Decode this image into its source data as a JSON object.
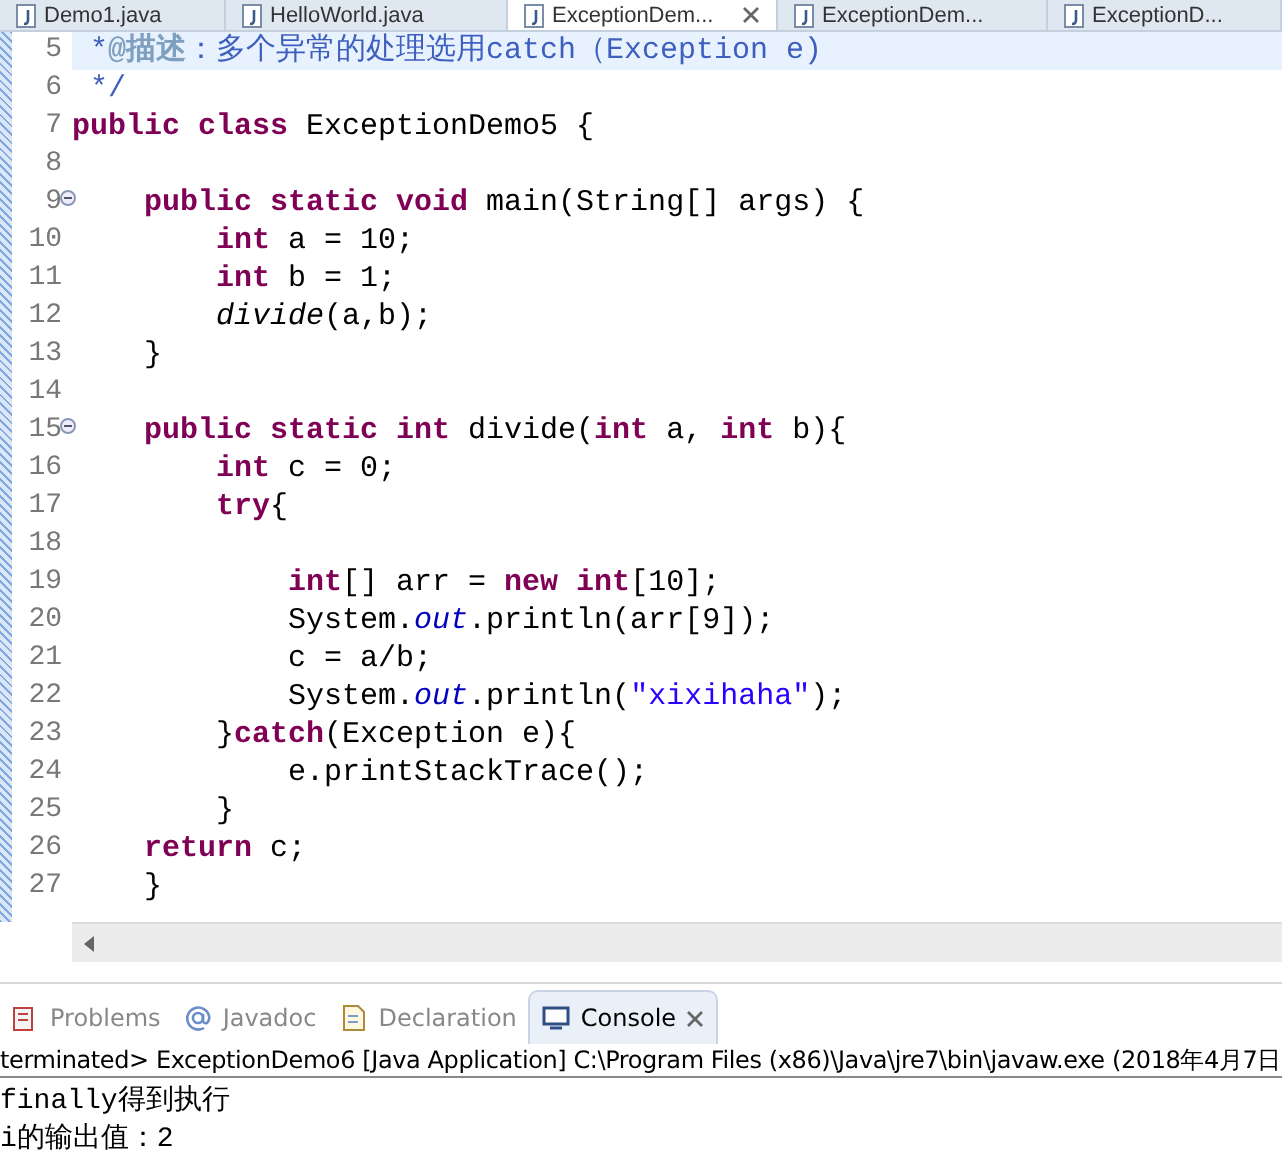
{
  "editor_tabs": [
    {
      "label": "Demo1.java",
      "selected": false,
      "closable": false
    },
    {
      "label": "HelloWorld.java",
      "selected": false,
      "closable": false
    },
    {
      "label": "ExceptionDem...",
      "selected": true,
      "closable": true
    },
    {
      "label": "ExceptionDem...",
      "selected": false,
      "closable": false
    },
    {
      "label": "ExceptionD...",
      "selected": false,
      "closable": false
    }
  ],
  "code_lines": [
    {
      "number": "5",
      "fold": false,
      "current": true,
      "tokens": [
        {
          "kind": "comment",
          "text": " *"
        },
        {
          "kind": "tag",
          "text": "@描述"
        },
        {
          "kind": "comment",
          "text": "：多个异常的处理选用catch（Exception e)"
        }
      ]
    },
    {
      "number": "6",
      "fold": false,
      "current": false,
      "tokens": [
        {
          "kind": "comment",
          "text": " */"
        }
      ]
    },
    {
      "number": "7",
      "fold": false,
      "current": false,
      "tokens": [
        {
          "kind": "kw",
          "text": "public class"
        },
        {
          "kind": "plain",
          "text": " ExceptionDemo5 {"
        }
      ]
    },
    {
      "number": "8",
      "fold": false,
      "current": false
    },
    {
      "number": "9",
      "fold": true,
      "current": false,
      "tokens": [
        {
          "kind": "kw",
          "text": "    public static void"
        },
        {
          "kind": "plain",
          "text": " main(String[] args) {"
        }
      ]
    },
    {
      "number": "10",
      "fold": false,
      "current": false,
      "tokens": [
        {
          "kind": "kw",
          "text": "        int"
        },
        {
          "kind": "plain",
          "text": " a = 10;"
        }
      ]
    },
    {
      "number": "11",
      "fold": false,
      "current": false,
      "tokens": [
        {
          "kind": "kw",
          "text": "        int"
        },
        {
          "kind": "plain",
          "text": " b = 1;"
        }
      ]
    },
    {
      "number": "12",
      "fold": false,
      "current": false,
      "tokens": [
        {
          "kind": "call",
          "text": "        divide"
        },
        {
          "kind": "plain",
          "text": "(a,b);"
        }
      ]
    },
    {
      "number": "13",
      "fold": false,
      "current": false,
      "tokens": [
        {
          "kind": "plain",
          "text": "    }"
        }
      ]
    },
    {
      "number": "14",
      "fold": false,
      "current": false
    },
    {
      "number": "15",
      "fold": true,
      "current": false,
      "tokens": [
        {
          "kind": "kw",
          "text": "    public static int"
        },
        {
          "kind": "plain",
          "text": " divide("
        },
        {
          "kind": "kw",
          "text": "int"
        },
        {
          "kind": "plain",
          "text": " a, "
        },
        {
          "kind": "kw",
          "text": "int"
        },
        {
          "kind": "plain",
          "text": " b){"
        }
      ]
    },
    {
      "number": "16",
      "fold": false,
      "current": false,
      "tokens": [
        {
          "kind": "kw",
          "text": "        int"
        },
        {
          "kind": "plain",
          "text": " c = 0;"
        }
      ]
    },
    {
      "number": "17",
      "fold": false,
      "current": false,
      "tokens": [
        {
          "kind": "kw",
          "text": "        try"
        },
        {
          "kind": "plain",
          "text": "{"
        }
      ]
    },
    {
      "number": "18",
      "fold": false,
      "current": false
    },
    {
      "number": "19",
      "fold": false,
      "current": false,
      "tokens": [
        {
          "kind": "kw",
          "text": "            int"
        },
        {
          "kind": "plain",
          "text": "[] arr = "
        },
        {
          "kind": "kw",
          "text": "new int"
        },
        {
          "kind": "plain",
          "text": "[10];"
        }
      ]
    },
    {
      "number": "20",
      "fold": false,
      "current": false,
      "tokens": [
        {
          "kind": "plain",
          "text": "            System."
        },
        {
          "kind": "field",
          "text": "out"
        },
        {
          "kind": "plain",
          "text": ".println(arr[9]);"
        }
      ]
    },
    {
      "number": "21",
      "fold": false,
      "current": false,
      "tokens": [
        {
          "kind": "plain",
          "text": "            c = a/b;"
        }
      ]
    },
    {
      "number": "22",
      "fold": false,
      "current": false,
      "tokens": [
        {
          "kind": "plain",
          "text": "            System."
        },
        {
          "kind": "field",
          "text": "out"
        },
        {
          "kind": "plain",
          "text": ".println("
        },
        {
          "kind": "string",
          "text": "\"xixihaha\""
        },
        {
          "kind": "plain",
          "text": ");"
        }
      ]
    },
    {
      "number": "23",
      "fold": false,
      "current": false,
      "tokens": [
        {
          "kind": "plain",
          "text": "        }"
        },
        {
          "kind": "kw",
          "text": "catch"
        },
        {
          "kind": "plain",
          "text": "(Exception e){"
        }
      ]
    },
    {
      "number": "24",
      "fold": false,
      "current": false,
      "tokens": [
        {
          "kind": "plain",
          "text": "            e.printStackTrace();"
        }
      ]
    },
    {
      "number": "25",
      "fold": false,
      "current": false,
      "tokens": [
        {
          "kind": "plain",
          "text": "        }"
        }
      ]
    },
    {
      "number": "26",
      "fold": false,
      "current": false,
      "tokens": [
        {
          "kind": "kw",
          "text": "    return"
        },
        {
          "kind": "plain",
          "text": " c;"
        }
      ]
    },
    {
      "number": "27",
      "fold": false,
      "current": false,
      "tokens": [
        {
          "kind": "plain",
          "text": "    }"
        }
      ]
    }
  ],
  "view_tabs": [
    {
      "label": "Problems",
      "kind": "problems",
      "selected": false,
      "closable": false
    },
    {
      "label": "Javadoc",
      "kind": "javadoc",
      "selected": false,
      "closable": false
    },
    {
      "label": "Declaration",
      "kind": "declaration",
      "selected": false,
      "closable": false
    },
    {
      "label": "Console",
      "kind": "console",
      "selected": true,
      "closable": true
    }
  ],
  "console": {
    "header": "terminated> ExceptionDemo6 [Java Application] C:\\Program Files (x86)\\Java\\jre7\\bin\\javaw.exe (2018年4月7日",
    "output": [
      "finally得到执行",
      "i的输出值：2"
    ]
  }
}
